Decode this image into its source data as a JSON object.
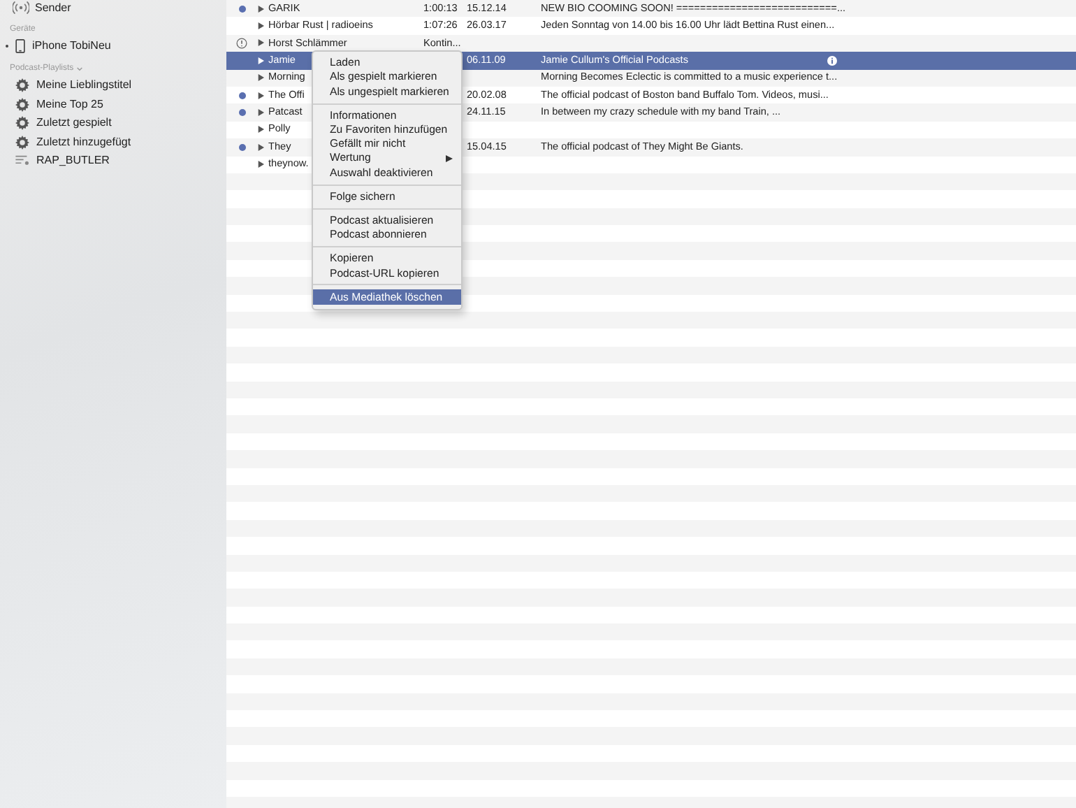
{
  "sidebar": {
    "top_item": {
      "label": "Sender"
    },
    "sections": [
      {
        "header": "Geräte",
        "collapsible": false,
        "items": [
          {
            "label": "iPhone TobiNeu",
            "kind": "device"
          }
        ]
      },
      {
        "header": "Podcast-Playlists",
        "collapsible": true,
        "items": [
          {
            "label": "Meine Lieblingstitel",
            "kind": "smart"
          },
          {
            "label": "Meine Top 25",
            "kind": "smart"
          },
          {
            "label": "Zuletzt gespielt",
            "kind": "smart"
          },
          {
            "label": "Zuletzt hinzugefügt",
            "kind": "smart"
          },
          {
            "label": "RAP_BUTLER",
            "kind": "playlist"
          }
        ]
      }
    ]
  },
  "table": {
    "rows": [
      {
        "name": "GARIK",
        "duration": "1:00:13",
        "date": "15.12.14",
        "description": "NEW BIO COOMING SOON! ===========================...",
        "unplayed": true,
        "alert": false,
        "info": false,
        "selected": false
      },
      {
        "name": "Hörbar Rust | radioeins",
        "duration": "1:07:26",
        "date": "26.03.17",
        "description": "Jeden Sonntag von 14.00 bis 16.00 Uhr lädt Bettina Rust einen...",
        "unplayed": false,
        "alert": false,
        "info": false,
        "selected": false
      },
      {
        "name": "Horst Schlämmer",
        "duration": "Kontin...",
        "unplayed": false,
        "alert": true,
        "info": false,
        "selected": false
      },
      {
        "name": "Jamie",
        "date": "06.11.09",
        "description": "Jamie Cullum's Official Podcasts",
        "unplayed": false,
        "alert": false,
        "info": true,
        "selected": true
      },
      {
        "name": "Morning",
        "description": "Morning Becomes Eclectic is committed to a music experience t...",
        "unplayed": false,
        "alert": false,
        "info": false,
        "selected": false
      },
      {
        "name": "The Offi",
        "date": "20.02.08",
        "description": "The official podcast of Boston band Buffalo Tom. Videos, musi...",
        "unplayed": true,
        "alert": false,
        "info": false,
        "selected": false
      },
      {
        "name": "Patcast",
        "date": "24.11.15",
        "description": "In between my crazy schedule with my band Train, ...",
        "unplayed": true,
        "alert": false,
        "info": false,
        "selected": false
      },
      {
        "name": "Polly",
        "unplayed": false,
        "alert": false,
        "info": false,
        "selected": false
      },
      {
        "name": "They",
        "date": "15.04.15",
        "description": "The official podcast of They Might Be Giants.",
        "unplayed": true,
        "alert": false,
        "info": false,
        "selected": false
      },
      {
        "name": "theynow.",
        "unplayed": false,
        "alert": false,
        "info": false,
        "selected": false
      }
    ]
  },
  "context_menu": {
    "groups": [
      [
        {
          "label": "Laden",
          "submenu": false,
          "selected": false
        },
        {
          "label": "Als gespielt markieren",
          "submenu": false,
          "selected": false
        },
        {
          "label": "Als ungespielt markieren",
          "submenu": false,
          "selected": false
        }
      ],
      [
        {
          "label": "Informationen",
          "submenu": false,
          "selected": false
        },
        {
          "label": "Zu Favoriten hinzufügen",
          "submenu": false,
          "selected": false
        },
        {
          "label": "Gefällt mir nicht",
          "submenu": false,
          "selected": false
        },
        {
          "label": "Wertung",
          "submenu": true,
          "selected": false
        },
        {
          "label": "Auswahl deaktivieren",
          "submenu": false,
          "selected": false
        }
      ],
      [
        {
          "label": "Folge sichern",
          "submenu": false,
          "selected": false
        }
      ],
      [
        {
          "label": "Podcast aktualisieren",
          "submenu": false,
          "selected": false
        },
        {
          "label": "Podcast abonnieren",
          "submenu": false,
          "selected": false
        }
      ],
      [
        {
          "label": "Kopieren",
          "submenu": false,
          "selected": false
        },
        {
          "label": "Podcast-URL kopieren",
          "submenu": false,
          "selected": false
        }
      ],
      [
        {
          "label": "Aus Mediathek löschen",
          "submenu": false,
          "selected": true
        }
      ]
    ]
  }
}
